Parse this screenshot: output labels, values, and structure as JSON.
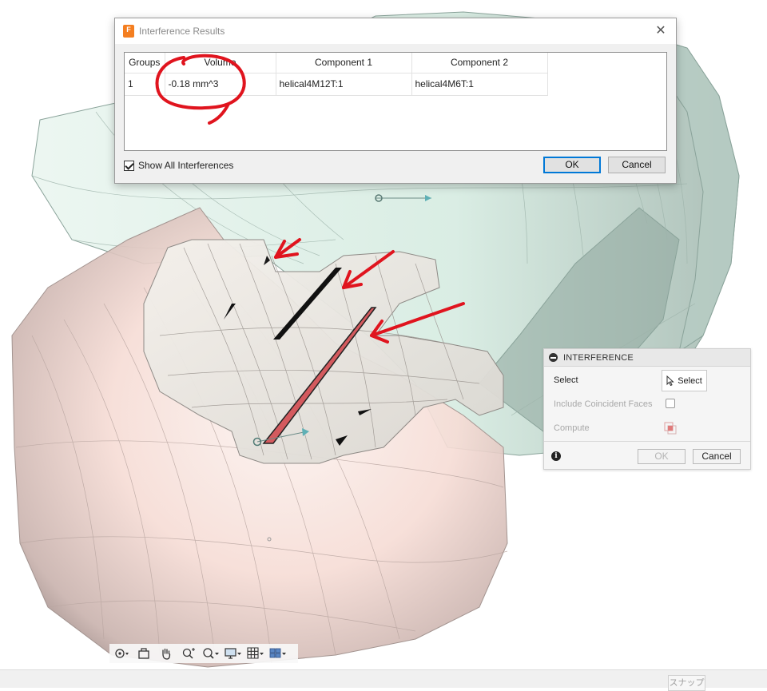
{
  "dialog": {
    "title": "Interference Results",
    "columns": [
      "Groups",
      "Volume",
      "Component 1",
      "Component 2"
    ],
    "rows": [
      {
        "group": "1",
        "volume": "-0.18 mm^3",
        "component1": "helical4M12T:1",
        "component2": "helical4M6T:1"
      }
    ],
    "show_all_label": "Show All Interferences",
    "show_all_checked": true,
    "ok_label": "OK",
    "cancel_label": "Cancel"
  },
  "panel": {
    "title": "INTERFERENCE",
    "select_label": "Select",
    "select_button_label": "Select",
    "coincident_label": "Include Coincident Faces",
    "compute_label": "Compute",
    "ok_label": "OK",
    "cancel_label": "Cancel"
  },
  "statusbar": {
    "snap_label": "スナップ"
  },
  "colors": {
    "annotation": "#e0141e",
    "green_gear": "#d7ece3",
    "pink_gear": "#f8e2dc",
    "interference_fill": "#d45a5e"
  }
}
